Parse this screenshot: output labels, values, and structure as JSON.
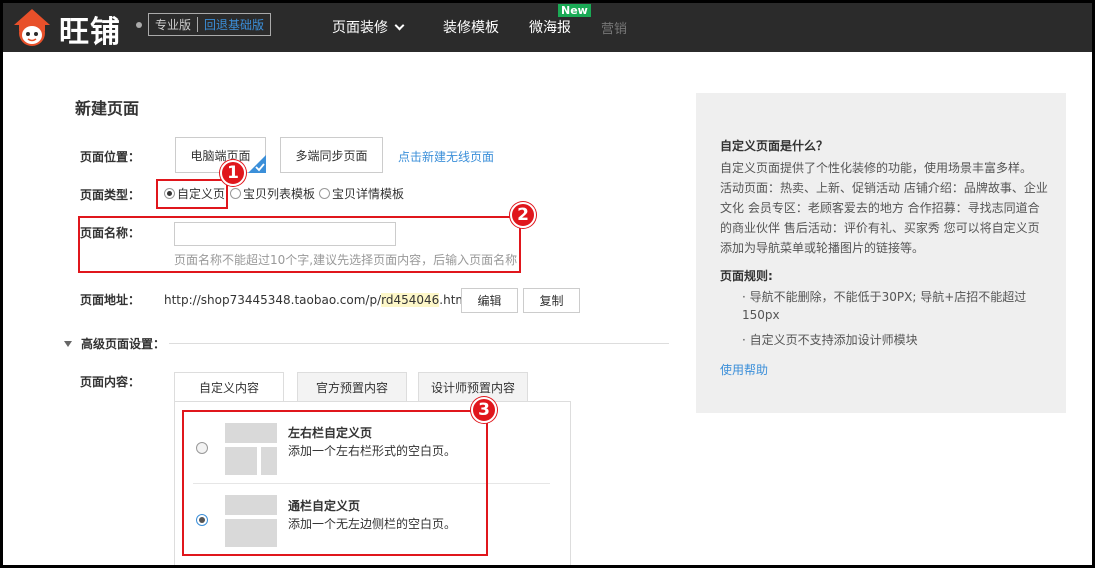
{
  "header": {
    "logo_text": "旺铺",
    "edition": "专业版",
    "back_basic": "回退基础版",
    "nav": [
      "页面装修",
      "装修模板",
      "微海报",
      "营销"
    ],
    "new_badge": "New"
  },
  "form": {
    "title": "新建页面",
    "position_label": "页面位置：",
    "pc_page": "电脑端页面",
    "multi_sync": "多端同步页面",
    "new_wireless_link": "点击新建无线页面",
    "type_label": "页面类型：",
    "types": [
      "自定义页",
      "宝贝列表模板",
      "宝贝详情模板"
    ],
    "type_selected": "自定义页",
    "name_label": "页面名称：",
    "name_value": "",
    "name_hint": "页面名称不能超过10个字,建议先选择页面内容，后输入页面名称",
    "url_label": "页面地址：",
    "url_prefix": "http://shop73445348.taobao.com/p/",
    "url_highlight": "rd454046",
    "url_suffix": ".htm",
    "edit_button": "编辑",
    "copy_button": "复制",
    "advanced_label": "高级页面设置：",
    "content_label": "页面内容：",
    "tabs": [
      "自定义内容",
      "官方预置内容",
      "设计师预置内容"
    ],
    "active_tab": "自定义内容",
    "options": [
      {
        "title": "左右栏自定义页",
        "desc": "添加一个左右栏形式的空白页。",
        "selected": false
      },
      {
        "title": "通栏自定义页",
        "desc": "添加一个无左边侧栏的空白页。",
        "selected": true
      }
    ]
  },
  "markers": [
    "1",
    "2",
    "3"
  ],
  "help": {
    "q_title": "自定义页面是什么？",
    "intro": "自定义页面提供了个性化装修的功能，使用场景丰富多样。",
    "scenes": "活动页面：热卖、上新、促销活动 店铺介绍：品牌故事、企业文化 会员专区：老顾客爱去的地方 合作招募：寻找志同道合的商业伙伴 售后活动：评价有礼、买家秀 您可以将自定义页添加为导航菜单或轮播图片的链接等。",
    "rules_title": "页面规则:",
    "rules": [
      "· 导航不能删除，不能低于30PX; 导航+店招不能超过150px",
      "· 自定义页不支持添加设计师模块"
    ],
    "help_link": "使用帮助"
  },
  "colors": {
    "topbar": "#2b2b2b",
    "accent": "#3b8fd9",
    "marker": "#e0161c",
    "new_badge": "#1aaa55"
  }
}
